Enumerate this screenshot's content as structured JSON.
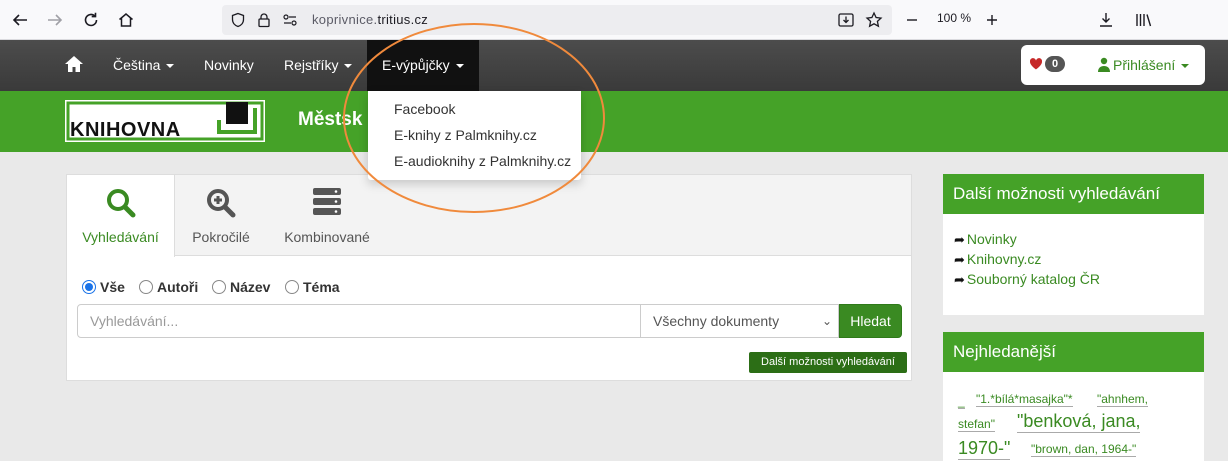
{
  "browser": {
    "url_host": "koprivnice.",
    "url_domain": "tritius.cz",
    "zoom": "100 %"
  },
  "navbar": {
    "items": [
      {
        "label": "Čeština",
        "dropdown": true
      },
      {
        "label": "Novinky",
        "dropdown": false
      },
      {
        "label": "Rejstříky",
        "dropdown": true
      },
      {
        "label": "E-výpůjčky",
        "dropdown": true,
        "active": true
      }
    ],
    "favorites_count": "0",
    "login_label": "Přihlášení"
  },
  "header": {
    "logo_text": "KNIHOVNA",
    "site_title": "Městsk"
  },
  "dropdown": {
    "items": [
      "Facebook",
      "E-knihy z Palmknihy.cz",
      "E-audioknihy z Palmknihy.cz"
    ]
  },
  "search": {
    "tabs": [
      {
        "label": "Vyhledávání",
        "icon": "search-icon",
        "active": true
      },
      {
        "label": "Pokročilé",
        "icon": "zoom-plus-icon",
        "active": false
      },
      {
        "label": "Kombinované",
        "icon": "server-icon",
        "active": false
      }
    ],
    "radios": [
      {
        "label": "Vše",
        "checked": true
      },
      {
        "label": "Autoři",
        "checked": false
      },
      {
        "label": "Název",
        "checked": false
      },
      {
        "label": "Téma",
        "checked": false
      }
    ],
    "placeholder": "Vyhledávání...",
    "doc_type": "Všechny dokumenty",
    "button_label": "Hledat",
    "more_label": "Další možnosti vyhledávání"
  },
  "sidebar": {
    "box1_title": "Další možnosti vyhledávání",
    "links": [
      "Novinky",
      "Knihovny.cz",
      "Souborný katalog ČR"
    ],
    "box2_title": "Nejhledanější",
    "tags": [
      "_",
      "\"1.*bílá*masajka\"*",
      "\"ahnhem,",
      "stefan\"",
      "\"benková, jana,",
      "1970-\"",
      "\"brown, dan, 1964-\""
    ]
  },
  "colors": {
    "accent_green": "#45a228",
    "link_green": "#3a8a22",
    "navbar_dark": "#3a3a3a",
    "annotation_orange": "#f08a3c"
  }
}
